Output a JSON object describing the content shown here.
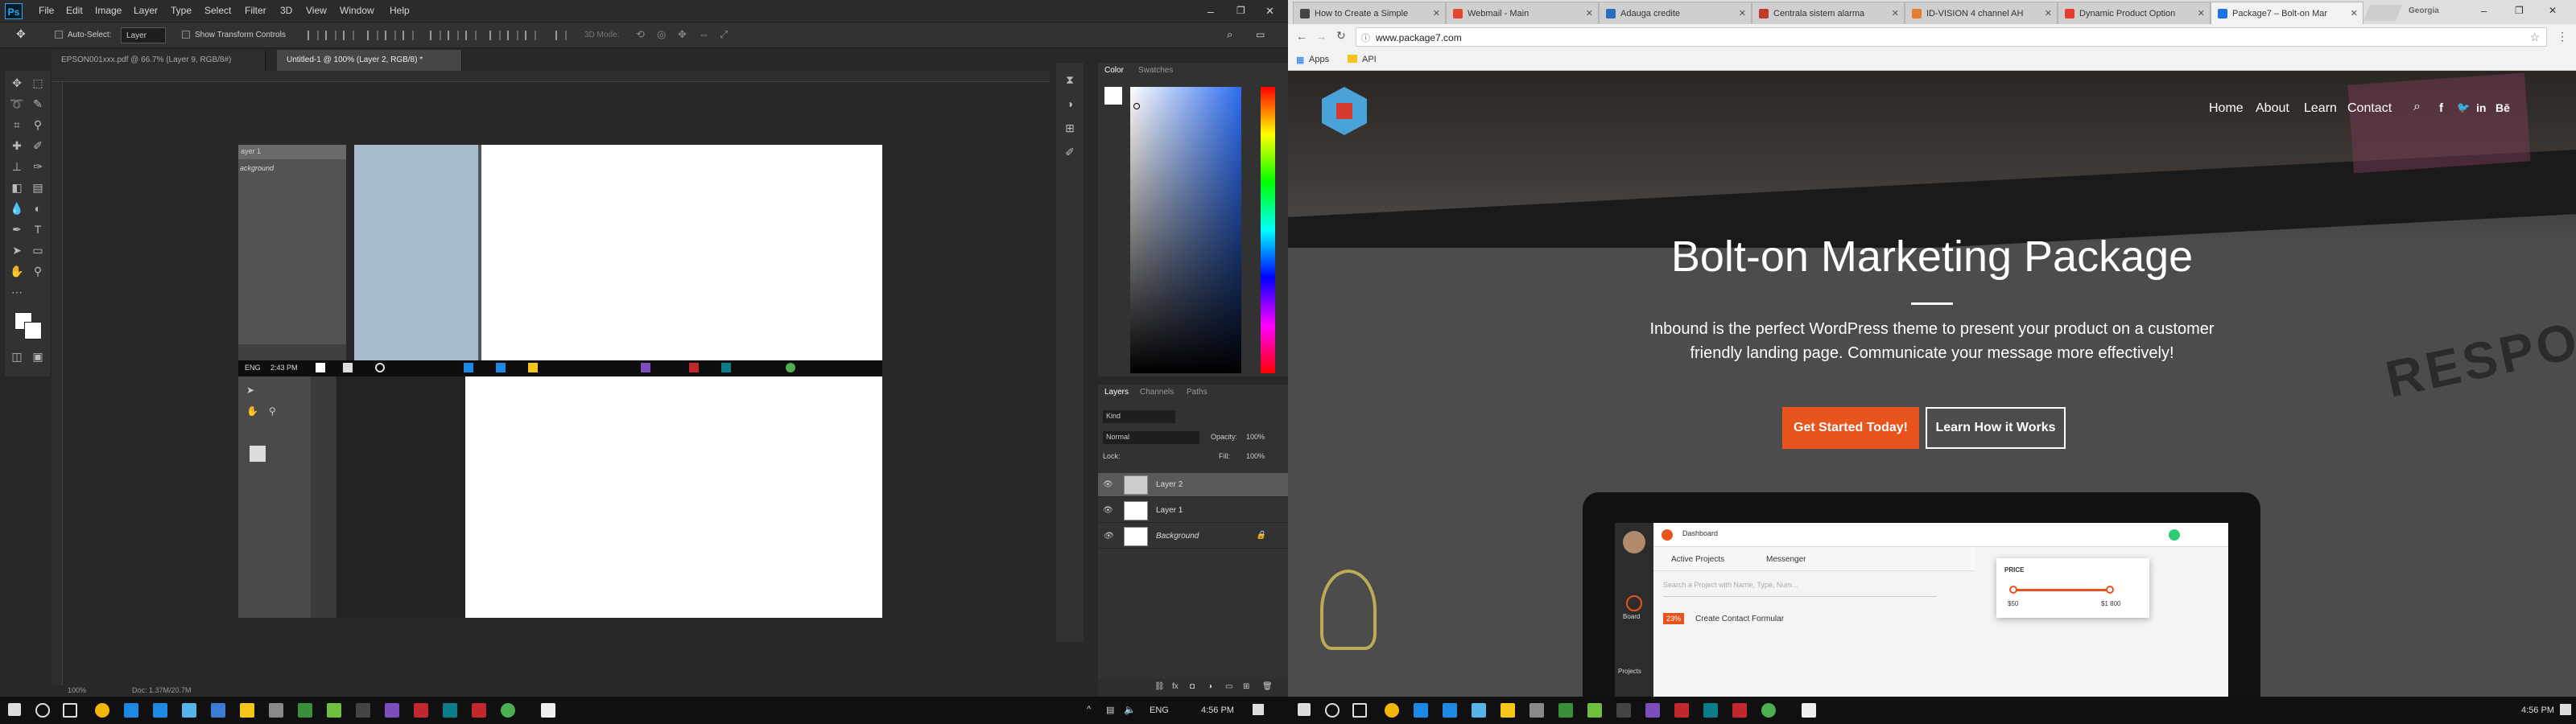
{
  "photoshop": {
    "logo": "Ps",
    "menu": [
      "File",
      "Edit",
      "Image",
      "Layer",
      "Type",
      "Select",
      "Filter",
      "3D",
      "View",
      "Window",
      "Help"
    ],
    "options": {
      "auto_select_label": "Auto-Select:",
      "auto_select_value": "Layer",
      "transform_label": "Show Transform Controls",
      "mode_3d": "3D Mode:"
    },
    "doc_tabs": [
      "EPSON001xxx.pdf @ 66.7% (Layer 9, RGB/8#)",
      "Untitled-1 @ 100% (Layer 2, RGB/8) *"
    ],
    "status": {
      "zoom": "100%",
      "doc": "Doc: 1.37M/20.7M"
    },
    "color_panel": {
      "tabs": [
        "Color",
        "Swatches"
      ]
    },
    "layers_panel": {
      "tabs": [
        "Layers",
        "Channels",
        "Paths"
      ],
      "filter": "Kind",
      "blend": "Normal",
      "opacity_label": "Opacity:",
      "opacity": "100%",
      "lock_label": "Lock:",
      "fill_label": "Fill:",
      "fill": "100%",
      "layers": [
        {
          "name": "Layer 2"
        },
        {
          "name": "Layer 1"
        },
        {
          "name": "Background"
        }
      ]
    },
    "embedded": {
      "layer_header": "ayer 1",
      "bg_label": "ackground",
      "lang": "ENG",
      "time": "2:43 PM"
    }
  },
  "chrome": {
    "tabs": [
      {
        "title": "How to Create a Simple",
        "color": "#444"
      },
      {
        "title": "Webmail - Main",
        "color": "#e8442e"
      },
      {
        "title": "Adauga credite",
        "color": "#2a6ebb"
      },
      {
        "title": "Centrala sistem alarma",
        "color": "#c0392b"
      },
      {
        "title": "ID-VISION 4 channel AH",
        "color": "#e57d2e"
      },
      {
        "title": "Dynamic Product Option",
        "color": "#e63b2e"
      },
      {
        "title": "Package7 – Bolt-on Mar",
        "color": "#1a73e8"
      }
    ],
    "user": "Georgia",
    "url": "www.package7.com",
    "bookmarks": [
      "Apps",
      "API"
    ]
  },
  "site": {
    "nav": [
      "Home",
      "About",
      "Learn",
      "Contact"
    ],
    "hero_title": "Bolt-on Marketing Package",
    "hero_text_1": "Inbound is the perfect WordPress theme to present your product on a customer",
    "hero_text_2": "friendly landing page. Communicate your message more effectively!",
    "cta_primary": "Get Started Today!",
    "cta_secondary": "Learn How it Works",
    "laptop": {
      "dashboard": "Dashboard",
      "active_projects": "Active Projects",
      "messenger": "Messenger",
      "price_label": "PRICE",
      "price_min": "$50",
      "price_max": "$1 800",
      "search_ph": "Search a Project with Name, Type, Num...",
      "task_pct": "23%",
      "task": "Create Contact Formular",
      "board": "Board",
      "projects": "Projects"
    },
    "colors": {
      "accent": "#e8531e",
      "logo": "#4aa3d8"
    }
  },
  "taskbar": {
    "lang": "ENG",
    "time_left": "4:56 PM",
    "time_right": "4:56 PM"
  }
}
